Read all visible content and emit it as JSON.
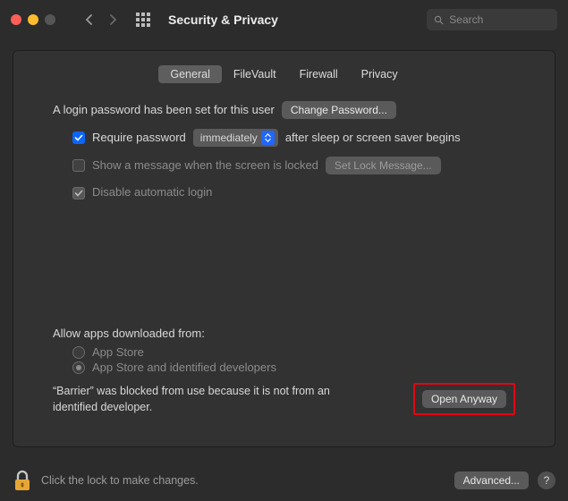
{
  "window": {
    "title": "Security & Privacy"
  },
  "search": {
    "placeholder": "Search"
  },
  "tabs": {
    "general": "General",
    "filevault": "FileVault",
    "firewall": "Firewall",
    "privacy": "Privacy"
  },
  "general": {
    "login_password_set": "A login password has been set for this user",
    "change_password_btn": "Change Password...",
    "require_password_label_pre": "Require password",
    "require_password_select": "immediately",
    "require_password_label_post": "after sleep or screen saver begins",
    "show_message_label": "Show a message when the screen is locked",
    "set_lock_message_btn": "Set Lock Message...",
    "disable_auto_login_label": "Disable automatic login"
  },
  "gatekeeper": {
    "heading": "Allow apps downloaded from:",
    "opt_appstore": "App Store",
    "opt_appstore_dev": "App Store and identified developers",
    "blocked_message": "“Barrier” was blocked from use because it is not from an identified developer.",
    "open_anyway_btn": "Open Anyway"
  },
  "footer": {
    "lock_text": "Click the lock to make changes.",
    "advanced_btn": "Advanced...",
    "help": "?"
  }
}
